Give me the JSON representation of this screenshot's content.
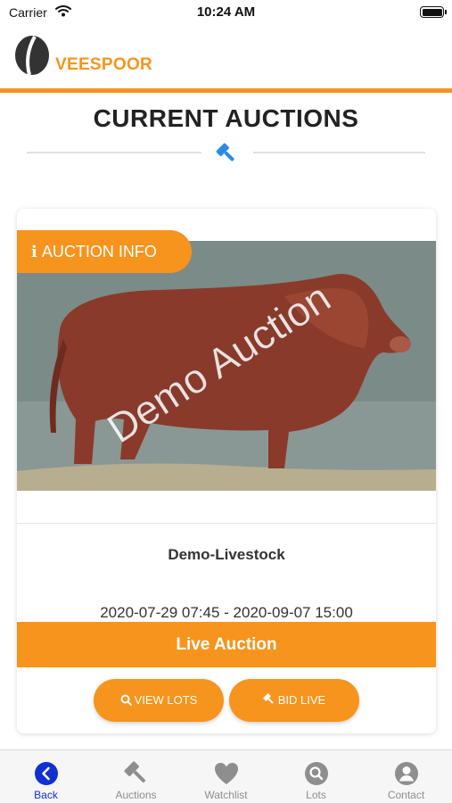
{
  "status_bar": {
    "carrier": "Carrier",
    "time": "10:24 AM"
  },
  "header": {
    "brand": "VEESPOOR",
    "brand_color": "#f7941d"
  },
  "page": {
    "title": "CURRENT AUCTIONS",
    "divider_icon": "gavel-icon"
  },
  "auction": {
    "info_badge": "AUCTION INFO",
    "info_icon": "info-icon",
    "image_watermark": "Demo Auction",
    "name": "Demo-Livestock",
    "dates": "2020-07-29 07:45 - 2020-09-07 15:00",
    "status": "Live Auction",
    "buttons": {
      "view_lots": "VIEW LOTS",
      "bid_live": "BID LIVE"
    }
  },
  "tab_bar": {
    "items": [
      {
        "label": "Back",
        "icon": "back-icon",
        "active": true
      },
      {
        "label": "Auctions",
        "icon": "gavel-icon",
        "active": false
      },
      {
        "label": "Watchlist",
        "icon": "heart-icon",
        "active": false
      },
      {
        "label": "Lots",
        "icon": "search-icon",
        "active": false
      },
      {
        "label": "Contact",
        "icon": "user-icon",
        "active": false
      }
    ]
  },
  "colors": {
    "accent": "#f7941d",
    "active_tab": "#1030d0",
    "inactive_tab": "#8e8e8e"
  }
}
